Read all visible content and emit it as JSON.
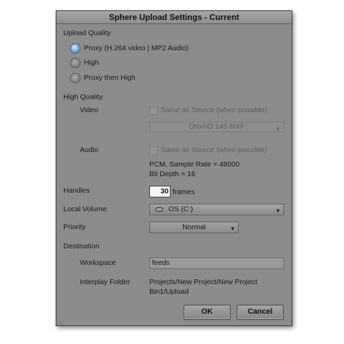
{
  "dialog": {
    "title": "Sphere Upload Settings - Current"
  },
  "upload_quality": {
    "label": "Upload Quality",
    "options": [
      "Proxy (H.264 video | MP2 Audio)",
      "High",
      "Proxy then High"
    ],
    "selected": "Proxy (H.264 video | MP2 Audio)"
  },
  "high_quality": {
    "label": "High Quality",
    "video": {
      "label": "Video",
      "checkbox_label": "Same as Source (when possible)",
      "checked": false,
      "format_value": "DNxHD 145  MXF"
    },
    "audio": {
      "label": "Audio",
      "checkbox_label": "Same as Source (when possible)",
      "checked": false,
      "info_line1": "PCM, Sample Rate = 48000",
      "info_line2": "Bit Depth = 16"
    }
  },
  "handles": {
    "label": "Handles",
    "value": "30",
    "unit": "frames"
  },
  "local_volume": {
    "label": "Local Volume",
    "value": "OS (C:)",
    "icon": "drive-icon"
  },
  "priority": {
    "label": "Priority",
    "value": "Normal"
  },
  "destination": {
    "label": "Destination",
    "workspace_label": "Workspace",
    "workspace_value": "feeds",
    "folder_label": "Interplay Folder",
    "folder_line1": "Projects/New Project/New Project",
    "folder_line2": "Bin1/Upload"
  },
  "buttons": {
    "ok": "OK",
    "cancel": "Cancel"
  }
}
